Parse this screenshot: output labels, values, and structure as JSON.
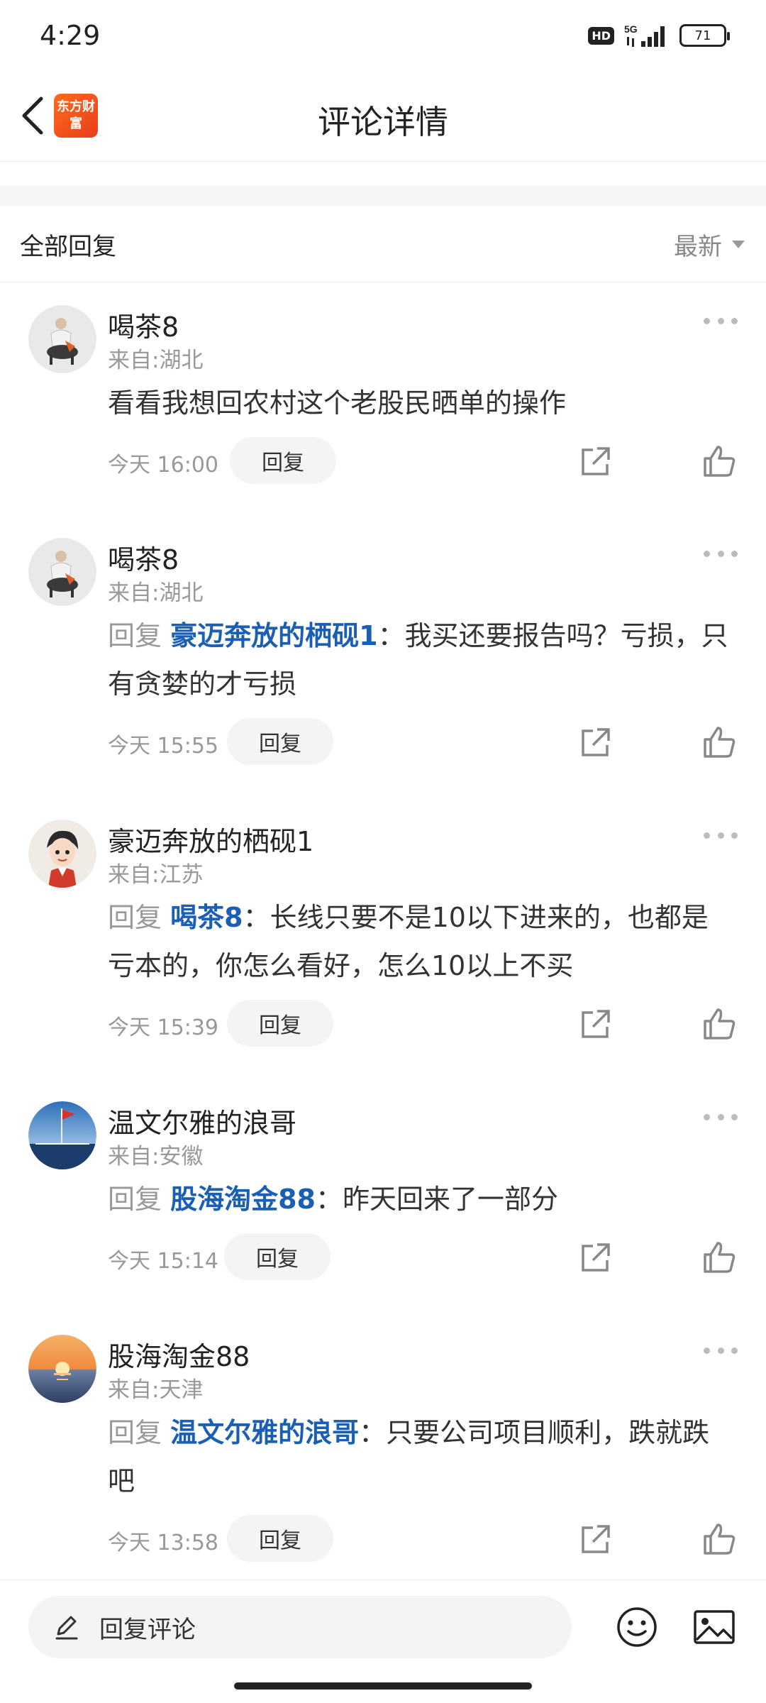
{
  "status_bar": {
    "time": "4:29",
    "hd": "HD",
    "network": "5G",
    "battery": "71"
  },
  "nav": {
    "title": "评论详情",
    "logo_text": "东方财富"
  },
  "section": {
    "title": "全部回复",
    "sort": "最新"
  },
  "comments": [
    {
      "username": "喝茶8",
      "location": "来自:湖北",
      "reply_prefix": "",
      "mention": "",
      "text": "看看我想回农村这个老股民晒单的操作",
      "time": "今天 16:00",
      "reply_label": "回复",
      "avatar": "avatar-illustration"
    },
    {
      "username": "喝茶8",
      "location": "来自:湖北",
      "reply_prefix": "回复",
      "mention": "豪迈奔放的栖砚1",
      "text": "：我买还要报告吗？亏损，只有贪婪的才亏损",
      "time": "今天 15:55",
      "reply_label": "回复",
      "avatar": "avatar-illustration"
    },
    {
      "username": "豪迈奔放的栖砚1",
      "location": "来自:江苏",
      "reply_prefix": "回复",
      "mention": "喝茶8",
      "text": "：长线只要不是10以下进来的，也都是亏本的，你怎么看好，怎么10以上不买",
      "time": "今天 15:39",
      "reply_label": "回复",
      "avatar": "avatar-cartoon-boy"
    },
    {
      "username": "温文尔雅的浪哥",
      "location": "来自:安徽",
      "reply_prefix": "回复",
      "mention": "股海淘金88",
      "text": "：昨天回来了一部分",
      "time": "今天 15:14",
      "reply_label": "回复",
      "avatar": "avatar-flag-sea"
    },
    {
      "username": "股海淘金88",
      "location": "来自:天津",
      "reply_prefix": "回复",
      "mention": "温文尔雅的浪哥",
      "text": "：只要公司项目顺利，跌就跌吧",
      "time": "今天 13:58",
      "reply_label": "回复",
      "avatar": "avatar-sunset"
    }
  ],
  "bottom_bar": {
    "reply_placeholder": "回复评论"
  },
  "colors": {
    "mention": "#1a5fb4",
    "secondary_text": "#999999",
    "pill_bg": "#f3f4f6",
    "brand": "#ff6a1a"
  }
}
